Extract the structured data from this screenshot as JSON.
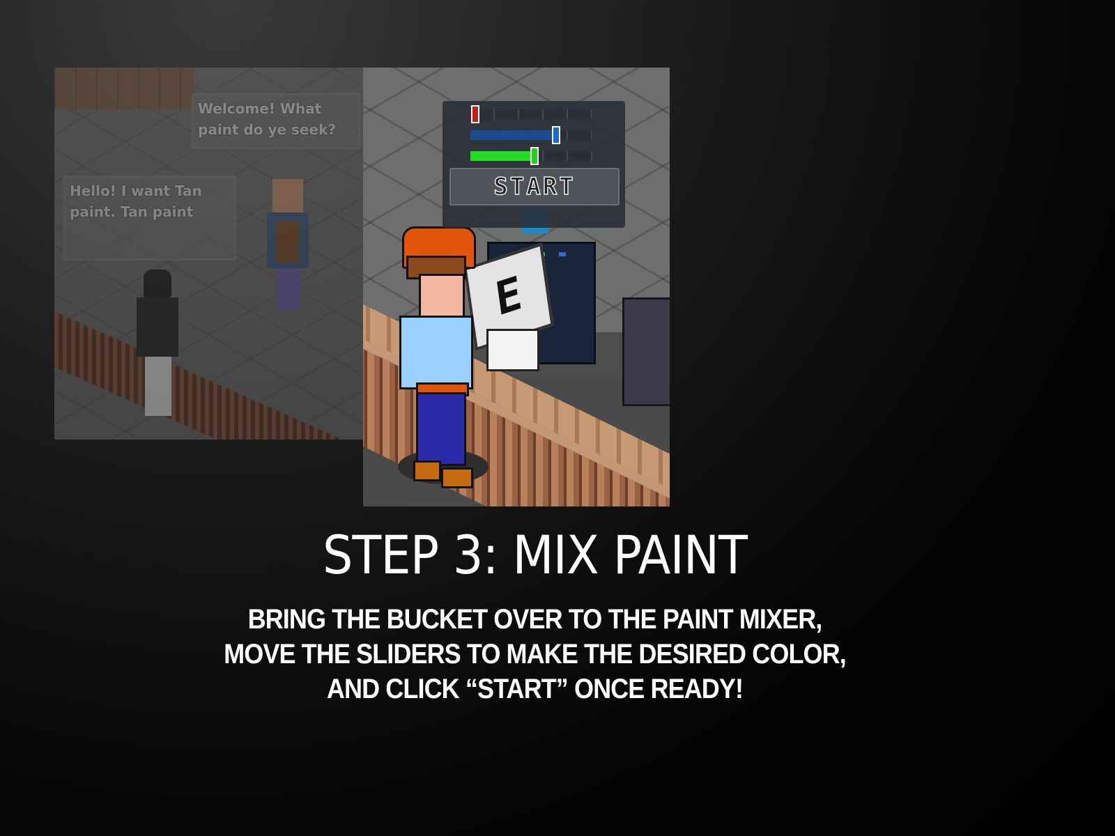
{
  "title": "STEP 3: MIX PAINT",
  "instructions": [
    "BRING THE BUCKET OVER TO THE PAINT MIXER,",
    "MOVE THE SLIDERS TO MAKE THE DESIRED COLOR,",
    "AND CLICK “START” ONCE READY!"
  ],
  "dialogue": {
    "npc": "Welcome! What paint do ye seek?",
    "player": "Hello! I want Tan paint. Tan paint"
  },
  "mixer": {
    "start_label": "START",
    "sign_label": "E",
    "sliders": [
      {
        "name": "red",
        "level": 0.04,
        "color": "#c0201a",
        "fill_color": "#8a1010"
      },
      {
        "name": "blue",
        "level": 0.7,
        "color": "#1a6ad0",
        "fill_color": "#1a4a90"
      },
      {
        "name": "green",
        "level": 0.52,
        "color": "#22d022",
        "fill_color": "#22dd22"
      }
    ],
    "preview_color": "#1a8ac8"
  }
}
